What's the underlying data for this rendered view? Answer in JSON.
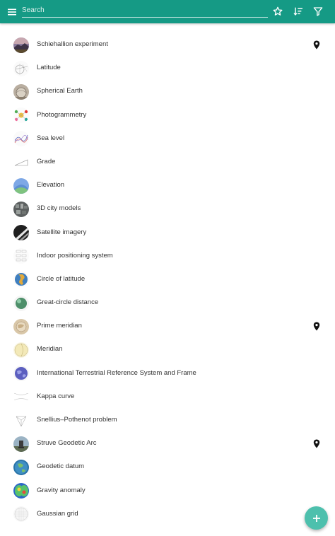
{
  "colors": {
    "appbar": "#159a85",
    "fab": "#4dc0ad",
    "text": "#333333"
  },
  "appbar": {
    "menu_icon": "menu-icon",
    "search_placeholder": "Search",
    "actions": [
      "star-icon",
      "sort-icon",
      "filter-icon"
    ]
  },
  "items": [
    {
      "label": "Schiehallion experiment",
      "icon": "mountain-thumbnail",
      "pin": true
    },
    {
      "label": "Latitude",
      "icon": "latitude-diagram-thumbnail",
      "pin": false
    },
    {
      "label": "Spherical Earth",
      "icon": "spherical-earth-thumbnail",
      "pin": false
    },
    {
      "label": "Photogrammetry",
      "icon": "photogrammetry-thumbnail",
      "pin": false
    },
    {
      "label": "Sea level",
      "icon": "sea-level-thumbnail",
      "pin": false
    },
    {
      "label": "Grade",
      "icon": "grade-thumbnail",
      "pin": false
    },
    {
      "label": "Elevation",
      "icon": "elevation-thumbnail",
      "pin": false
    },
    {
      "label": "3D city models",
      "icon": "city-models-thumbnail",
      "pin": false
    },
    {
      "label": "Satellite imagery",
      "icon": "satellite-thumbnail",
      "pin": false
    },
    {
      "label": "Indoor positioning system",
      "icon": "indoor-positioning-thumbnail",
      "pin": false
    },
    {
      "label": "Circle of latitude",
      "icon": "globe-thumbnail",
      "pin": false
    },
    {
      "label": "Great-circle distance",
      "icon": "sphere-thumbnail",
      "pin": false
    },
    {
      "label": "Prime meridian",
      "icon": "map-thumbnail",
      "pin": true
    },
    {
      "label": "Meridian",
      "icon": "meridian-thumbnail",
      "pin": false
    },
    {
      "label": "International Terrestrial Reference System and Frame",
      "icon": "earth-thumbnail",
      "pin": false
    },
    {
      "label": "Kappa curve",
      "icon": "kappa-curve-thumbnail",
      "pin": false
    },
    {
      "label": "Snellius–Pothenot problem",
      "icon": "triangle-diagram-thumbnail",
      "pin": false
    },
    {
      "label": "Struve Geodetic Arc",
      "icon": "monument-thumbnail",
      "pin": true
    },
    {
      "label": "Geodetic datum",
      "icon": "datum-globe-thumbnail",
      "pin": false
    },
    {
      "label": "Gravity anomaly",
      "icon": "gravity-map-thumbnail",
      "pin": false
    },
    {
      "label": "Gaussian grid",
      "icon": "gaussian-grid-thumbnail",
      "pin": false
    }
  ],
  "fab": {
    "icon": "plus-icon"
  }
}
